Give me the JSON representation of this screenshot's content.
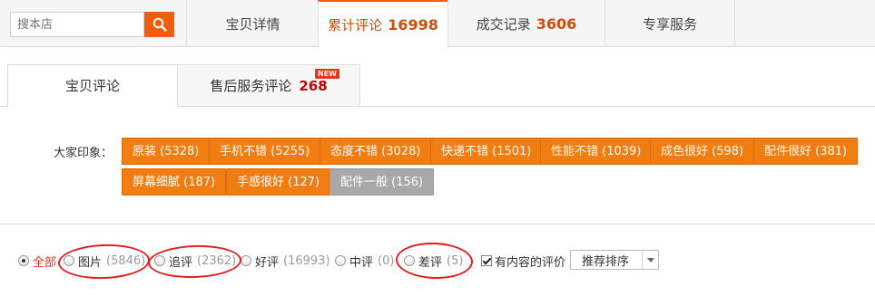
{
  "search": {
    "placeholder": "搜本店"
  },
  "top_tabs": [
    {
      "label": "宝贝详情",
      "count": ""
    },
    {
      "label": "累计评论",
      "count": "16998"
    },
    {
      "label": "成交记录",
      "count": "3606"
    },
    {
      "label": "专享服务",
      "count": ""
    }
  ],
  "sub_tabs": [
    {
      "label": "宝贝评论",
      "count": ""
    },
    {
      "label": "售后服务评论",
      "count": "268",
      "badge": "NEW"
    }
  ],
  "impressions": {
    "label": "大家印象：",
    "tags": [
      {
        "text": "原装 (5328)",
        "style": "orange"
      },
      {
        "text": "手机不错 (5255)",
        "style": "orange"
      },
      {
        "text": "态度不错 (3028)",
        "style": "orange"
      },
      {
        "text": "快递不错 (1501)",
        "style": "orange"
      },
      {
        "text": "性能不错 (1039)",
        "style": "orange"
      },
      {
        "text": "成色很好 (598)",
        "style": "orange"
      },
      {
        "text": "配件很好 (381)",
        "style": "orange"
      },
      {
        "text": "屏幕细腻 (187)",
        "style": "orange"
      },
      {
        "text": "手感很好 (127)",
        "style": "orange"
      },
      {
        "text": "配件一般 (156)",
        "style": "gray"
      }
    ]
  },
  "filters": {
    "all": {
      "label": "全部"
    },
    "pics": {
      "label": "图片",
      "count": "(5846)"
    },
    "followup": {
      "label": "追评",
      "count": "(2362)"
    },
    "good": {
      "label": "好评",
      "count": "(16993)"
    },
    "neutral": {
      "label": "中评",
      "count": "(0)"
    },
    "bad": {
      "label": "差评",
      "count": "(5)"
    },
    "with_content": {
      "label": "有内容的评价"
    },
    "sort": {
      "value": "推荐排序"
    }
  },
  "colors": {
    "accent": "#f25c0c",
    "tag_orange": "#f07d12",
    "tag_gray": "#a8a8a8",
    "annotation_red": "#e02020"
  }
}
